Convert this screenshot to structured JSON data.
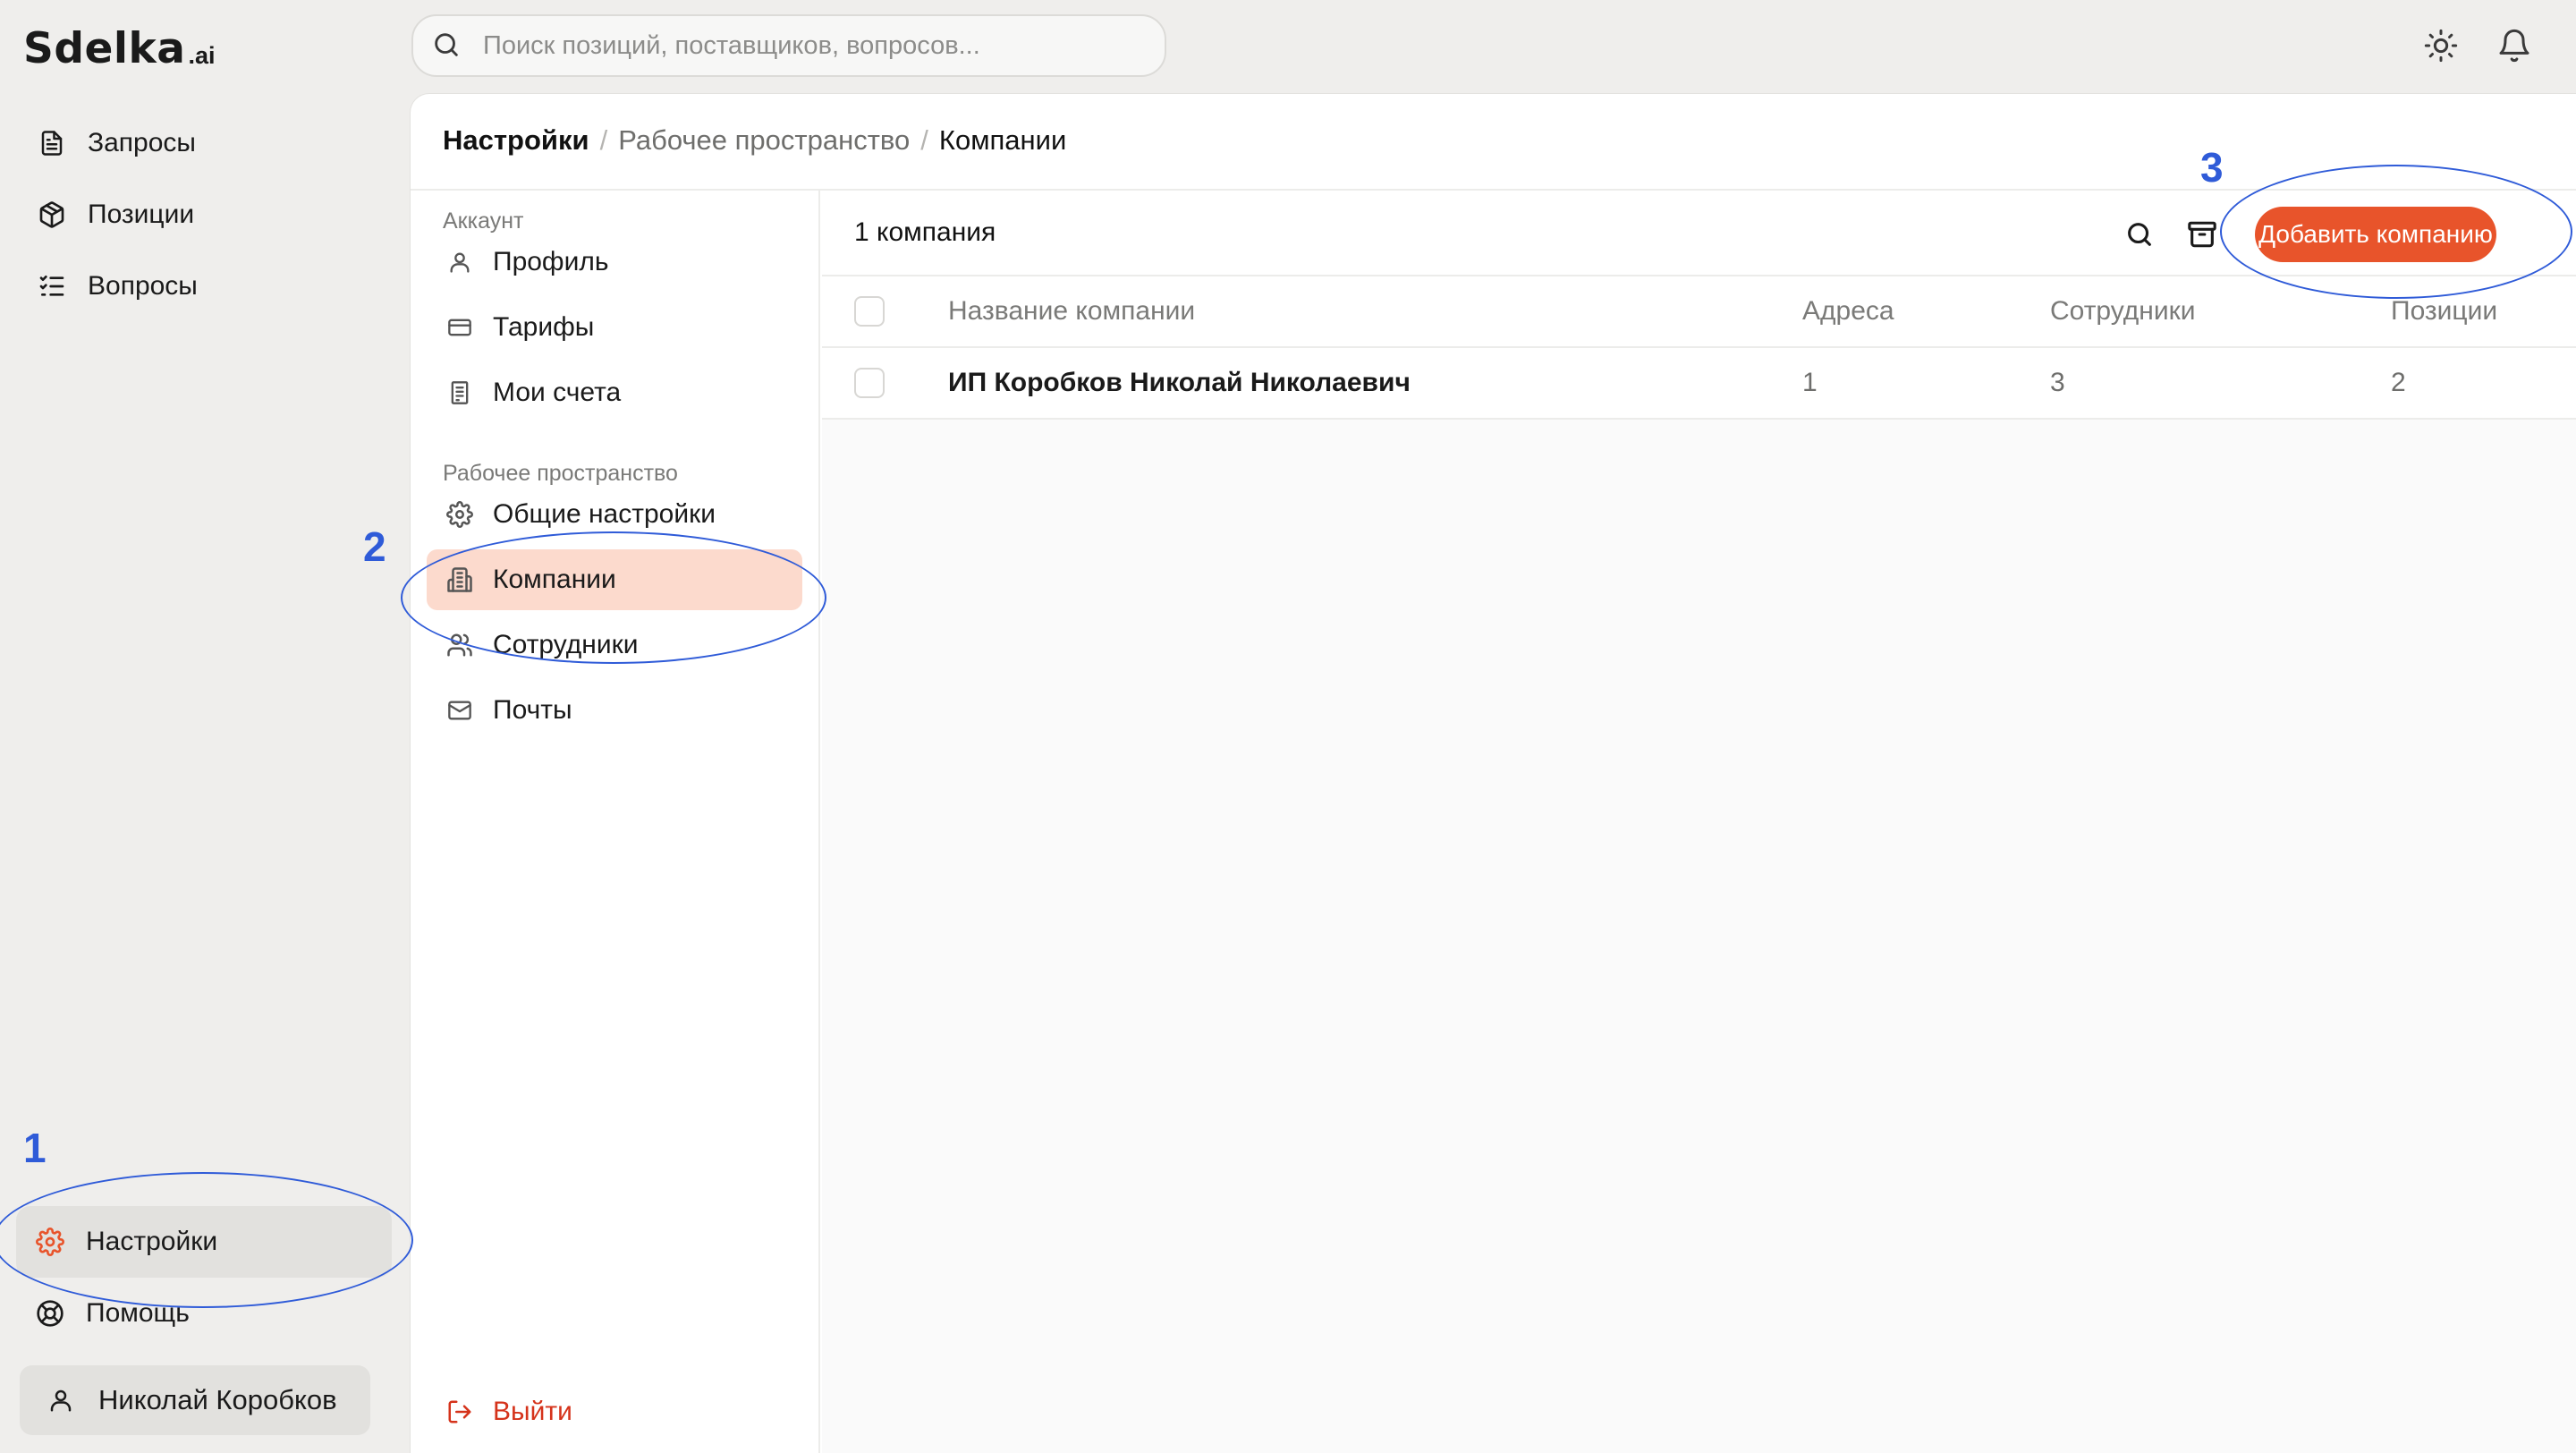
{
  "app": {
    "logo_main": "Sdelka",
    "logo_suffix": ".ai"
  },
  "sidebar": {
    "items": [
      {
        "label": "Запросы",
        "icon": "document-icon"
      },
      {
        "label": "Позиции",
        "icon": "box-icon"
      },
      {
        "label": "Вопросы",
        "icon": "checklist-icon"
      }
    ],
    "bottom_items": [
      {
        "label": "Настройки",
        "icon": "gear-icon",
        "active": true
      },
      {
        "label": "Помощь",
        "icon": "lifebuoy-icon"
      }
    ],
    "user_name": "Николай Коробков"
  },
  "search": {
    "placeholder": "Поиск позиций, поставщиков, вопросов..."
  },
  "header_icons": [
    "sun-icon",
    "bell-icon"
  ],
  "breadcrumb": {
    "root": "Настройки",
    "middle": "Рабочее пространство",
    "current": "Компании"
  },
  "settings_nav": {
    "account_heading": "Аккаунт",
    "account_items": [
      {
        "label": "Профиль",
        "icon": "user-icon"
      },
      {
        "label": "Тарифы",
        "icon": "card-icon"
      },
      {
        "label": "Мои счета",
        "icon": "receipt-icon"
      }
    ],
    "workspace_heading": "Рабочее пространство",
    "workspace_items": [
      {
        "label": "Общие настройки",
        "icon": "gear-icon"
      },
      {
        "label": "Компании",
        "icon": "building-icon",
        "active": true
      },
      {
        "label": "Сотрудники",
        "icon": "users-icon"
      },
      {
        "label": "Почты",
        "icon": "mail-icon"
      }
    ],
    "logout_label": "Выйти"
  },
  "companies": {
    "count_label": "1 компания",
    "add_button": "Добавить компанию",
    "columns": [
      "Название компании",
      "Адреса",
      "Сотрудники",
      "Позиции"
    ],
    "rows": [
      {
        "name": "ИП Коробков Николай Николаевич",
        "addresses": "1",
        "employees": "3",
        "positions": "2"
      }
    ]
  },
  "annotations": [
    "1",
    "2",
    "3"
  ],
  "colors": {
    "accent": "#e8542b",
    "active_highlight": "#fcdacd",
    "annotation": "#2f5bd8",
    "logout": "#d5331b"
  }
}
